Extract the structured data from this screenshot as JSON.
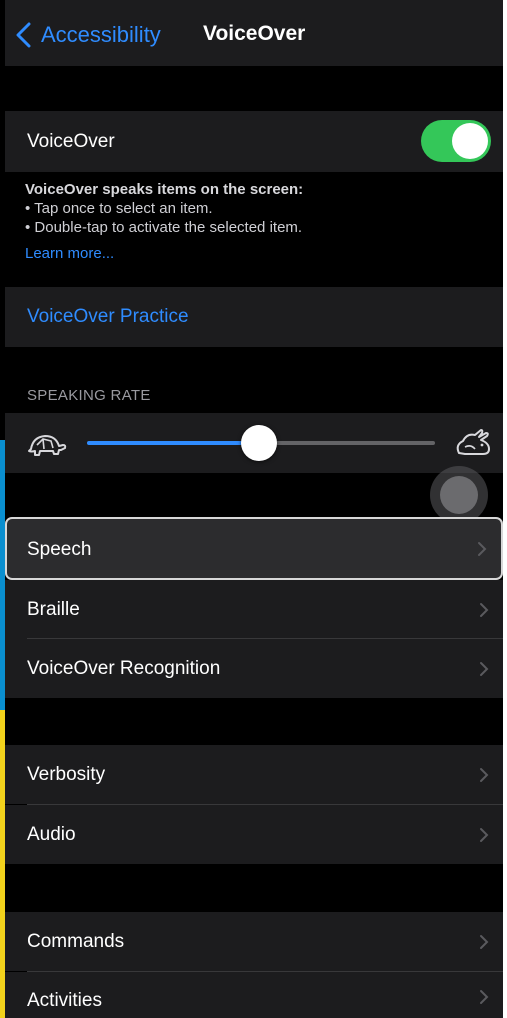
{
  "nav": {
    "back_label": "Accessibility",
    "title": "VoiceOver"
  },
  "voiceover_row": {
    "label": "VoiceOver",
    "toggle_on": true
  },
  "description": {
    "heading": "VoiceOver speaks items on the screen:",
    "line1": "• Tap once to select an item.",
    "line2": "• Double-tap to activate the selected item.",
    "learn_more": "Learn more..."
  },
  "practice": {
    "label": "VoiceOver Practice"
  },
  "speaking_rate": {
    "header": "SPEAKING RATE",
    "value": 0.5
  },
  "group1": [
    {
      "label": "Speech"
    },
    {
      "label": "Braille"
    },
    {
      "label": "VoiceOver Recognition"
    }
  ],
  "group2": [
    {
      "label": "Verbosity"
    },
    {
      "label": "Audio"
    }
  ],
  "group3": [
    {
      "label": "Commands"
    },
    {
      "label": "Activities"
    }
  ],
  "colors": {
    "accent": "#2f8cff",
    "toggle_on": "#34c759",
    "background": "#000000",
    "cell": "#1c1c1e"
  }
}
